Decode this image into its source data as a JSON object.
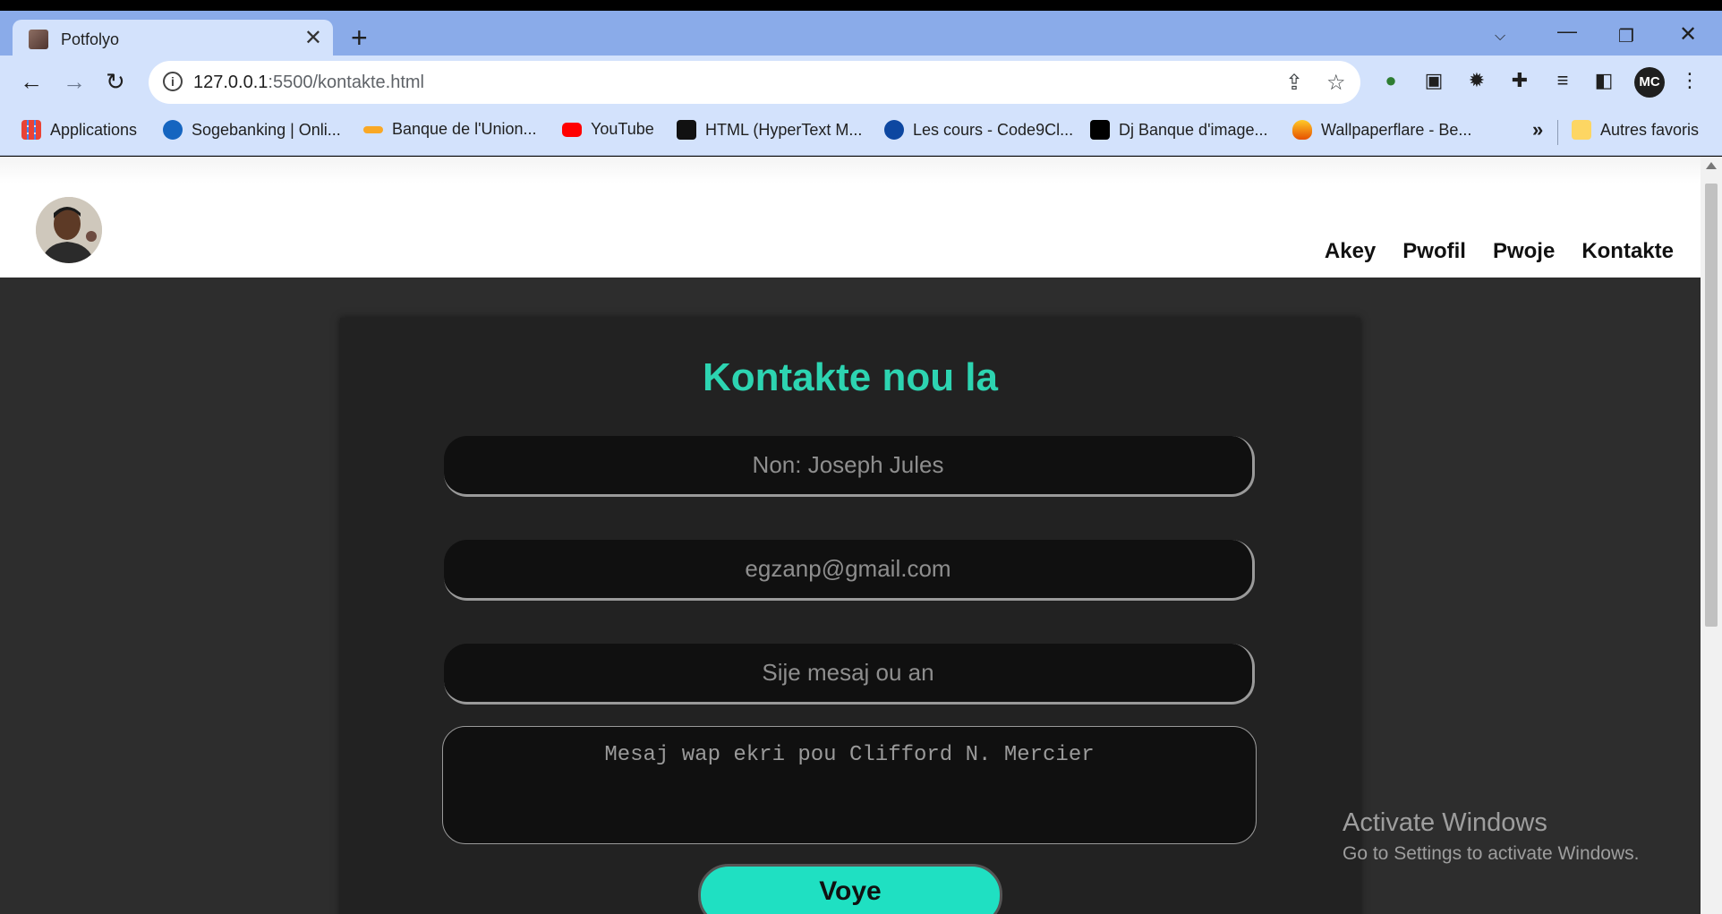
{
  "browser": {
    "tab_title": "Potfolyo",
    "tab_close": "✕",
    "new_tab": "+",
    "url_host": "127.0.0.1",
    "url_path": ":5500/kontakte.html",
    "window_controls": {
      "dropdown": "⌵",
      "minimize": "—",
      "maximize": "❐",
      "close": "✕"
    },
    "profile_initials": "MC"
  },
  "bookmarks": {
    "items": [
      {
        "label": "Applications",
        "color": "#ea4335"
      },
      {
        "label": "Sogebanking | Onli...",
        "color": "#1565c0"
      },
      {
        "label": "Banque de l'Union...",
        "color": "#f9a825"
      },
      {
        "label": "YouTube",
        "color": "#ff0000"
      },
      {
        "label": "HTML (HyperText M...",
        "color": "#111111"
      },
      {
        "label": "Les cours - Code9Cl...",
        "color": "#0d47a1"
      },
      {
        "label": "Dj Banque d'image...",
        "color": "#000000"
      },
      {
        "label": "Wallpaperflare - Be...",
        "color": "#e65100"
      }
    ],
    "more": "»",
    "other": "Autres favoris"
  },
  "site": {
    "nav": [
      "Akey",
      "Pwofil",
      "Pwoje",
      "Kontakte"
    ],
    "contact": {
      "title": "Kontakte nou la",
      "name_placeholder": "Non: Joseph Jules",
      "email_placeholder": "egzanp@gmail.com",
      "subject_placeholder": "Sije mesaj ou an",
      "message_placeholder": "Mesaj wap ekri pou Clifford N. Mercier",
      "send_label": "Voye"
    }
  },
  "watermark": {
    "line1": "Activate Windows",
    "line2": "Go to Settings to activate Windows."
  },
  "colors": {
    "accent": "#2dd4b1",
    "button": "#1fe0c2",
    "page_bg": "#2d2d2d",
    "card_bg": "#222222"
  }
}
